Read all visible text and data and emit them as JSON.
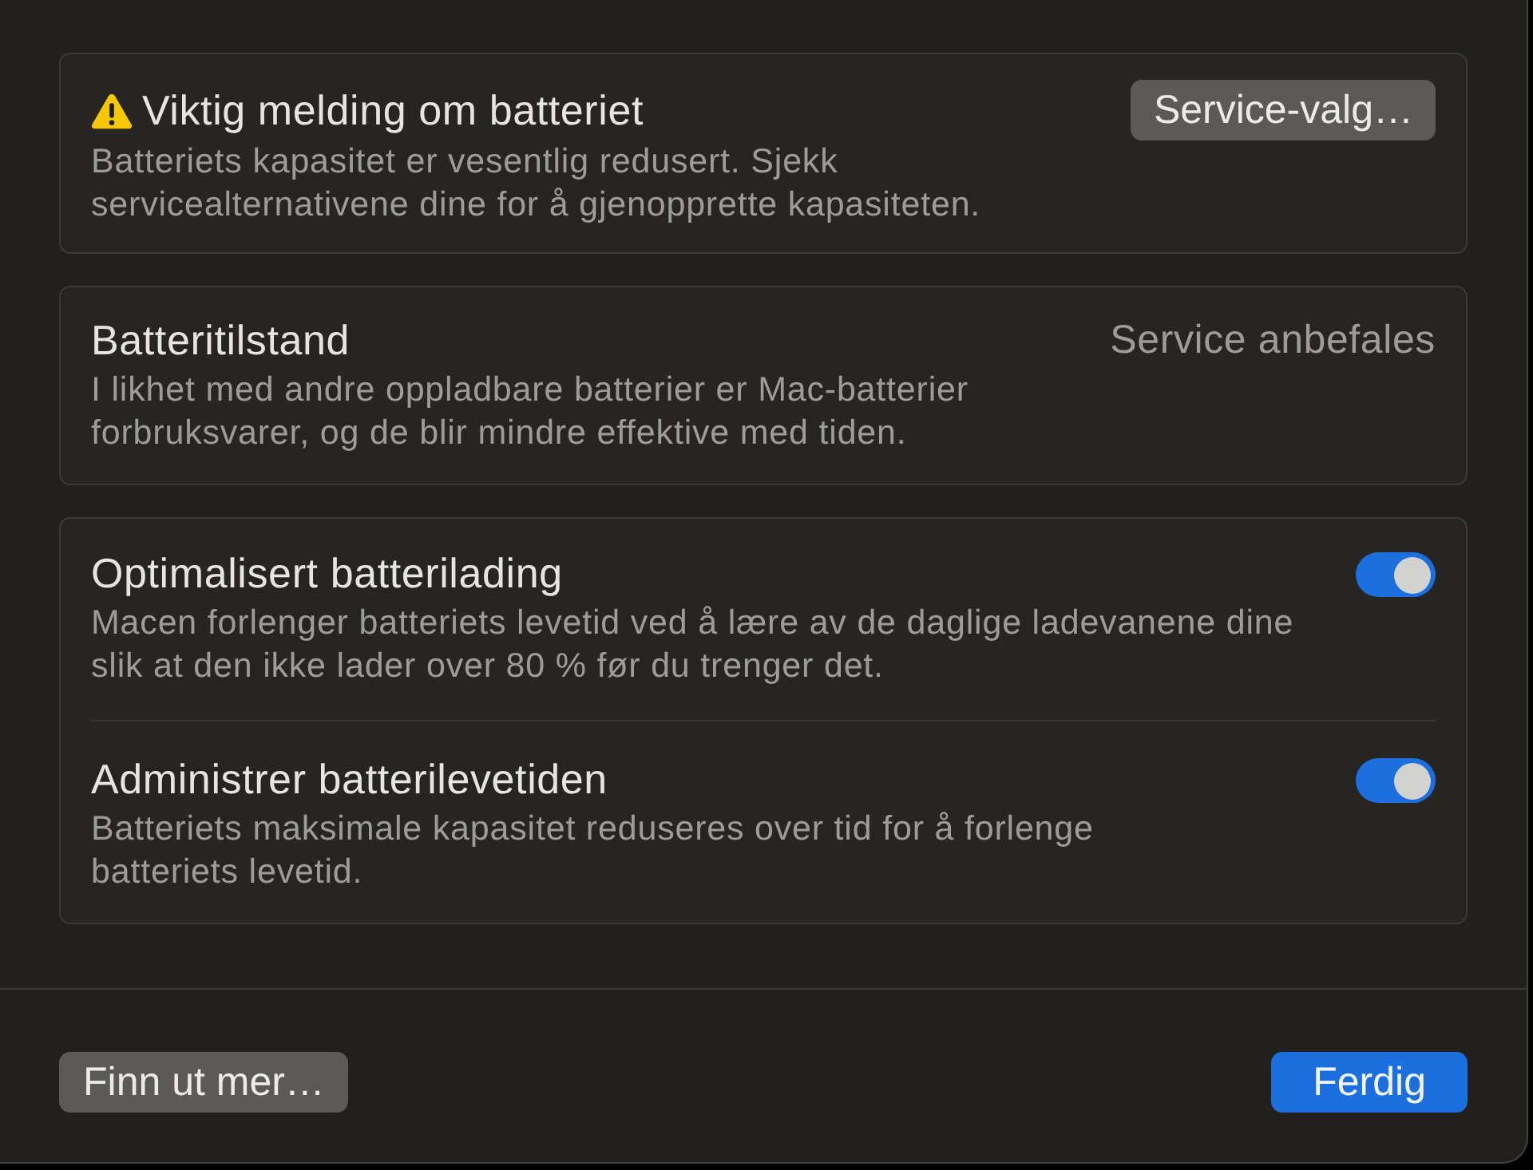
{
  "notice": {
    "title": "Viktig melding om batteriet",
    "description": "Batteriets kapasitet er vesentlig redusert. Sjekk\nservicealternativene dine for å gjenopprette kapasiteten.",
    "button": "Service-valg…"
  },
  "health": {
    "title": "Batteritilstand",
    "status": "Service anbefales",
    "description": "I likhet med andre oppladbare batterier er Mac-batterier\nforbruksvarer, og de blir mindre effektive med tiden."
  },
  "settings": [
    {
      "title": "Optimalisert batterilading",
      "description": "Macen forlenger batteriets levetid ved å lære av de daglige ladevanene dine\nslik at den ikke lader over 80 % før du trenger det.",
      "on": true
    },
    {
      "title": "Administrer batterilevetiden",
      "description": "Batteriets maksimale kapasitet reduseres over tid for å forlenge\nbatteriets levetid.",
      "on": true
    }
  ],
  "footer": {
    "help_button": "Finn ut mer…",
    "done_button": "Ferdig"
  }
}
